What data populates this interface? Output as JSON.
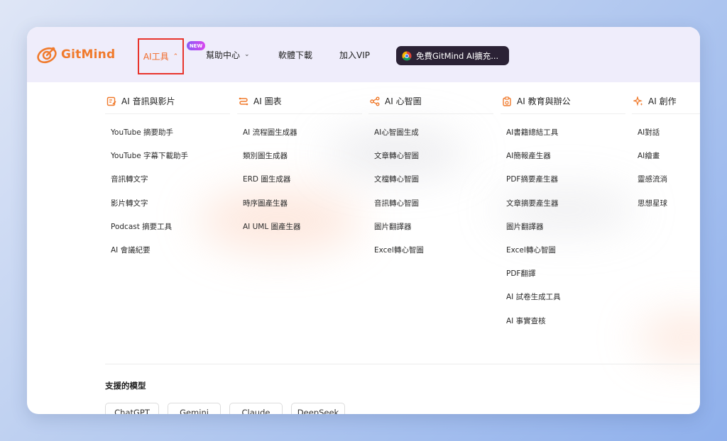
{
  "brand": {
    "name": "GitMind",
    "accent": "#f07a2c"
  },
  "nav": {
    "ai_tools": "AI工具",
    "new_badge": "NEW",
    "help_center": "幫助中心",
    "download": "軟體下載",
    "vip": "加入VIP",
    "promo": "免費GitMind AI擴充..."
  },
  "columns": [
    {
      "title": "AI 音訊與影片",
      "icon": "edit-document-icon",
      "items": [
        "YouTube 摘要助手",
        "YouTube 字幕下載助手",
        "音訊轉文字",
        "影片轉文字",
        "Podcast 摘要工具",
        "AI 會議紀要"
      ]
    },
    {
      "title": "AI 圖表",
      "icon": "flow-chart-icon",
      "items": [
        "AI 流程圖生成器",
        "類別圖生成器",
        "ERD 圖生成器",
        "時序圖產生器",
        "AI UML 圖產生器"
      ]
    },
    {
      "title": "AI 心智圖",
      "icon": "mind-map-icon",
      "items": [
        "AI心智圖生成",
        "文章轉心智圖",
        "文檔轉心智圖",
        "音訊轉心智圖",
        "圖片翻譯器",
        "Excel轉心智圖"
      ]
    },
    {
      "title": "AI 教育與辦公",
      "icon": "clipboard-icon",
      "items": [
        "AI書籍總結工具",
        "AI簡報產生器",
        "PDF摘要產生器",
        "文章摘要產生器",
        "圖片翻譯器",
        "Excel轉心智圖",
        "PDF翻譯",
        "AI 試卷生成工具",
        "AI 事實查核"
      ]
    },
    {
      "title": "AI 創作",
      "icon": "sparkle-icon",
      "items": [
        "AI對話",
        "AI繪畫",
        "靈感流淌",
        "思想星球"
      ]
    }
  ],
  "models": {
    "title": "支援的模型",
    "items": [
      "ChatGPT",
      "Gemini",
      "Claude",
      "DeepSeek"
    ]
  }
}
